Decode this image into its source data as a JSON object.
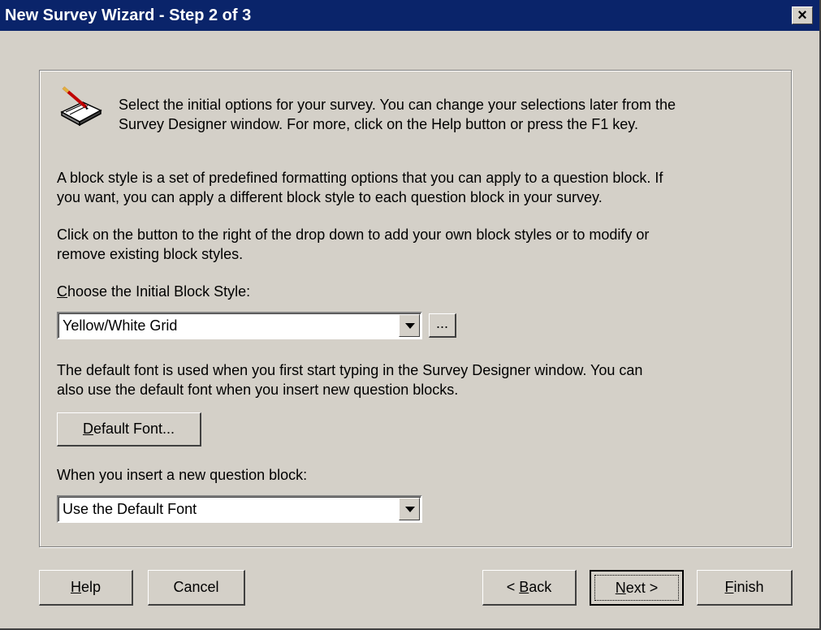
{
  "window": {
    "title": "New Survey Wizard - Step 2 of 3",
    "close_glyph": "×"
  },
  "intro": {
    "icon": "pencil-notepad-icon",
    "line1": "Select the initial options for your survey. You can change your selections later from the",
    "line2": "Survey Designer window. For more, click on the Help button or press the F1 key."
  },
  "block_style": {
    "para1_line1": "A block style is a set of predefined formatting options that you can apply to a question block. If",
    "para1_line2": "you want, you can apply a different block style to each question block in your survey.",
    "para2_line1": "Click on the button to the right of the drop down to add your own block styles or to modify or",
    "para2_line2": "remove existing block styles.",
    "choose_label_mnemonic": "C",
    "choose_label_rest": "hoose the Initial Block Style:",
    "selected": "Yellow/White Grid",
    "edit_button": "..."
  },
  "font": {
    "para_line1": "The default font is used when you first start typing in the Survey Designer window. You can",
    "para_line2": "also use the default font when you insert new question blocks.",
    "button_mnemonic": "D",
    "button_rest": "efault Font...",
    "insert_label": "When you insert a new question block:",
    "insert_selected": "Use the Default Font"
  },
  "buttons": {
    "help_mnemonic": "H",
    "help_rest": "elp",
    "cancel": "Cancel",
    "back_prefix": "< ",
    "back_mnemonic": "B",
    "back_rest": "ack",
    "next_mnemonic": "N",
    "next_rest": "ext >",
    "finish_mnemonic": "F",
    "finish_rest": "inish"
  }
}
